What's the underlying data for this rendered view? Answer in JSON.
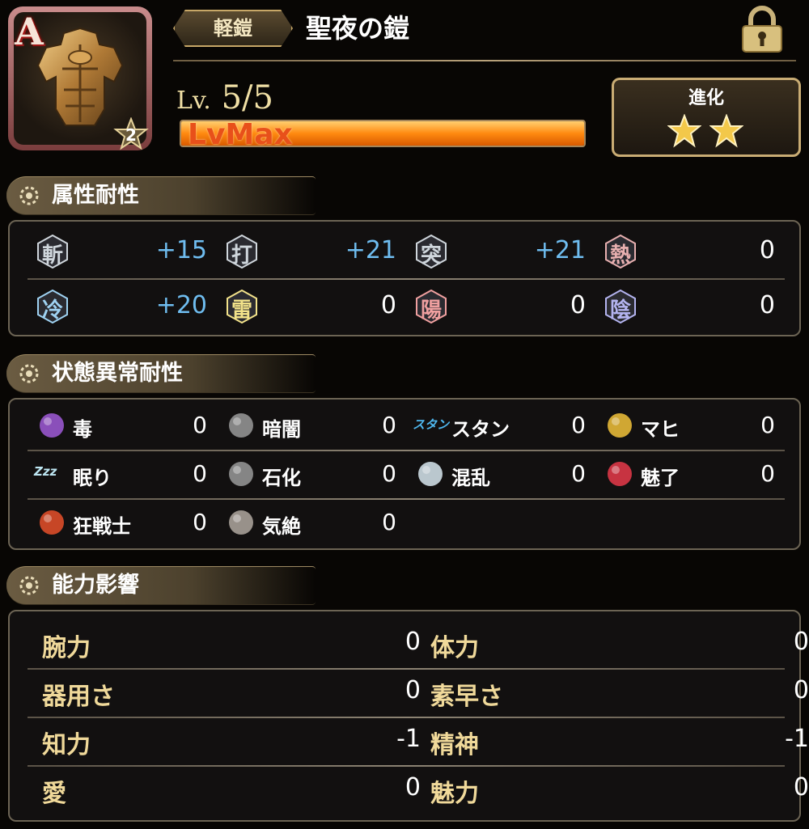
{
  "header": {
    "rank_letter": "A",
    "rank_badge": "2",
    "type": "軽鎧",
    "name": "聖夜の鎧",
    "level_prefix": "Lv.",
    "level": "5/5",
    "level_bar_text": "LvMax",
    "level_progress": 1.0,
    "evolution_label": "進化",
    "evolution_stars": 2
  },
  "sections": {
    "element": "属性耐性",
    "status": "状態異常耐性",
    "ability": "能力影響"
  },
  "elements": [
    {
      "glyph": "斬",
      "value": "+15",
      "icon": "slash-icon"
    },
    {
      "glyph": "打",
      "value": "+21",
      "icon": "blunt-icon"
    },
    {
      "glyph": "突",
      "value": "+21",
      "icon": "pierce-icon"
    },
    {
      "glyph": "熱",
      "value": "0",
      "icon": "fire-icon"
    },
    {
      "glyph": "冷",
      "value": "+20",
      "icon": "ice-icon"
    },
    {
      "glyph": "雷",
      "value": "0",
      "icon": "thunder-icon"
    },
    {
      "glyph": "陽",
      "value": "0",
      "icon": "light-icon"
    },
    {
      "glyph": "陰",
      "value": "0",
      "icon": "dark-icon"
    }
  ],
  "status": [
    {
      "label": "毒",
      "value": "0",
      "icon": "poison-icon"
    },
    {
      "label": "暗闇",
      "value": "0",
      "icon": "blind-icon"
    },
    {
      "label": "スタン",
      "value": "0",
      "icon": "stun-icon",
      "icon_text": "スタン"
    },
    {
      "label": "マヒ",
      "value": "0",
      "icon": "paralysis-icon"
    },
    {
      "label": "眠り",
      "value": "0",
      "icon": "sleep-icon",
      "icon_text": "Zzz"
    },
    {
      "label": "石化",
      "value": "0",
      "icon": "petrify-icon"
    },
    {
      "label": "混乱",
      "value": "0",
      "icon": "confusion-icon"
    },
    {
      "label": "魅了",
      "value": "0",
      "icon": "charm-icon"
    },
    {
      "label": "狂戦士",
      "value": "0",
      "icon": "berserk-icon"
    },
    {
      "label": "気絶",
      "value": "0",
      "icon": "faint-icon"
    }
  ],
  "abilities": [
    {
      "label": "腕力",
      "value": "0"
    },
    {
      "label": "体力",
      "value": "0"
    },
    {
      "label": "器用さ",
      "value": "0"
    },
    {
      "label": "素早さ",
      "value": "0"
    },
    {
      "label": "知力",
      "value": "-1"
    },
    {
      "label": "精神",
      "value": "-1"
    },
    {
      "label": "愛",
      "value": "0"
    },
    {
      "label": "魅力",
      "value": "0"
    }
  ],
  "colors": {
    "positive": "#6fbdf0",
    "gold_label": "#f0d99a",
    "bar_orange": "#ff8a10"
  }
}
